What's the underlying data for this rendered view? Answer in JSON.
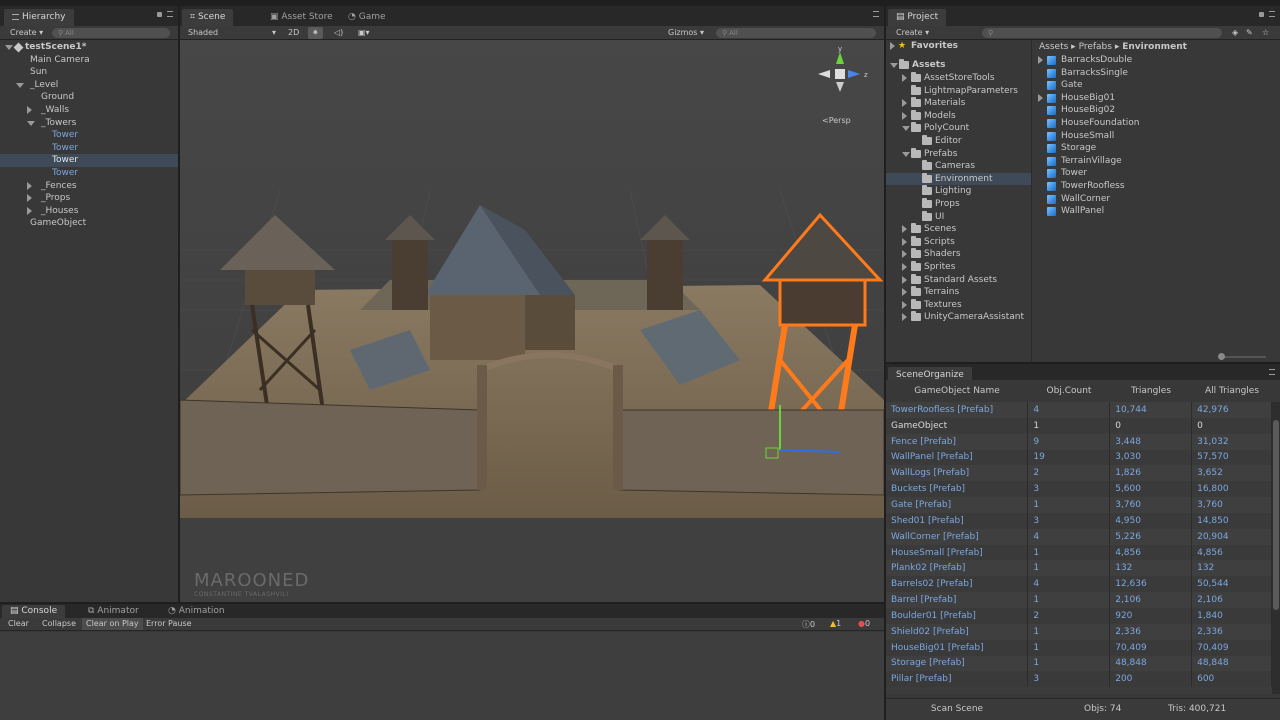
{
  "colors": {
    "prefab_blue": "#7ba7e0",
    "selection_orange": "#ff7a1a",
    "selected_row": "#3e4a58"
  },
  "hierarchy": {
    "tab": "Hierarchy",
    "create": "Create",
    "search_placeholder": "All",
    "items": [
      {
        "label": "testScene1*",
        "depth": 0,
        "arrow": "down",
        "bold": true,
        "prefab": false
      },
      {
        "label": "Main Camera",
        "depth": 1,
        "arrow": "",
        "bold": false,
        "prefab": false
      },
      {
        "label": "Sun",
        "depth": 1,
        "arrow": "",
        "bold": false,
        "prefab": false
      },
      {
        "label": "_Level",
        "depth": 1,
        "arrow": "down",
        "bold": false,
        "prefab": false
      },
      {
        "label": "Ground",
        "depth": 2,
        "arrow": "",
        "bold": false,
        "prefab": false
      },
      {
        "label": "_Walls",
        "depth": 2,
        "arrow": "right",
        "bold": false,
        "prefab": false
      },
      {
        "label": "_Towers",
        "depth": 2,
        "arrow": "down",
        "bold": false,
        "prefab": false
      },
      {
        "label": "Tower",
        "depth": 3,
        "arrow": "",
        "bold": false,
        "prefab": true
      },
      {
        "label": "Tower",
        "depth": 3,
        "arrow": "",
        "bold": false,
        "prefab": true
      },
      {
        "label": "Tower",
        "depth": 3,
        "arrow": "",
        "bold": false,
        "prefab": true,
        "selected": true
      },
      {
        "label": "Tower",
        "depth": 3,
        "arrow": "",
        "bold": false,
        "prefab": true
      },
      {
        "label": "_Fences",
        "depth": 2,
        "arrow": "right",
        "bold": false,
        "prefab": false
      },
      {
        "label": "_Props",
        "depth": 2,
        "arrow": "right",
        "bold": false,
        "prefab": false
      },
      {
        "label": "_Houses",
        "depth": 2,
        "arrow": "right",
        "bold": false,
        "prefab": false
      },
      {
        "label": "GameObject",
        "depth": 1,
        "arrow": "",
        "bold": false,
        "prefab": false
      }
    ]
  },
  "scene": {
    "tabs": [
      "Scene",
      "Asset Store",
      "Game"
    ],
    "shading": "Shaded",
    "mode_2d": "2D",
    "gizmos": "Gizmos",
    "search_placeholder": "All",
    "persp_label": "Persp",
    "watermark_title": "MAROONED",
    "watermark_sub": "CONSTANTINE TVALASHVILI"
  },
  "project": {
    "tab": "Project",
    "create": "Create",
    "favorites": "Favorites",
    "assets_root": "Assets",
    "breadcrumb": [
      "Assets",
      "Prefabs",
      "Environment"
    ],
    "folders": [
      {
        "label": "AssetStoreTools",
        "depth": 1,
        "arrow": "right"
      },
      {
        "label": "LightmapParameters",
        "depth": 1,
        "arrow": ""
      },
      {
        "label": "Materials",
        "depth": 1,
        "arrow": "right"
      },
      {
        "label": "Models",
        "depth": 1,
        "arrow": "right"
      },
      {
        "label": "PolyCount",
        "depth": 1,
        "arrow": "down"
      },
      {
        "label": "Editor",
        "depth": 2,
        "arrow": ""
      },
      {
        "label": "Prefabs",
        "depth": 1,
        "arrow": "down"
      },
      {
        "label": "Cameras",
        "depth": 2,
        "arrow": ""
      },
      {
        "label": "Environment",
        "depth": 2,
        "arrow": "",
        "selected": true
      },
      {
        "label": "Lighting",
        "depth": 2,
        "arrow": ""
      },
      {
        "label": "Props",
        "depth": 2,
        "arrow": ""
      },
      {
        "label": "UI",
        "depth": 2,
        "arrow": ""
      },
      {
        "label": "Scenes",
        "depth": 1,
        "arrow": "right"
      },
      {
        "label": "Scripts",
        "depth": 1,
        "arrow": "right"
      },
      {
        "label": "Shaders",
        "depth": 1,
        "arrow": "right"
      },
      {
        "label": "Sprites",
        "depth": 1,
        "arrow": "right"
      },
      {
        "label": "Standard Assets",
        "depth": 1,
        "arrow": "right"
      },
      {
        "label": "Terrains",
        "depth": 1,
        "arrow": "right"
      },
      {
        "label": "Textures",
        "depth": 1,
        "arrow": "right"
      },
      {
        "label": "UnityCameraAssistant",
        "depth": 1,
        "arrow": "right"
      }
    ],
    "files": [
      {
        "label": "BarracksDouble",
        "arrow": true
      },
      {
        "label": "BarracksSingle",
        "arrow": false
      },
      {
        "label": "Gate",
        "arrow": false
      },
      {
        "label": "HouseBig01",
        "arrow": true
      },
      {
        "label": "HouseBig02",
        "arrow": false
      },
      {
        "label": "HouseFoundation",
        "arrow": false
      },
      {
        "label": "HouseSmall",
        "arrow": false
      },
      {
        "label": "Storage",
        "arrow": false
      },
      {
        "label": "TerrainVillage",
        "arrow": false
      },
      {
        "label": "Tower",
        "arrow": false
      },
      {
        "label": "TowerRoofless",
        "arrow": false
      },
      {
        "label": "WallCorner",
        "arrow": false
      },
      {
        "label": "WallPanel",
        "arrow": false
      }
    ]
  },
  "scene_organize": {
    "tab": "SceneOrganize",
    "columns": [
      "GameObject Name",
      "Obj.Count",
      "Triangles",
      "All Triangles"
    ],
    "rows": [
      {
        "name": "TowerRoofless [Prefab]",
        "count": "4",
        "tris": "10,744",
        "all": "42,976",
        "prefab": true
      },
      {
        "name": "GameObject",
        "count": "1",
        "tris": "0",
        "all": "0",
        "prefab": false
      },
      {
        "name": "Fence [Prefab]",
        "count": "9",
        "tris": "3,448",
        "all": "31,032",
        "prefab": true
      },
      {
        "name": "WallPanel [Prefab]",
        "count": "19",
        "tris": "3,030",
        "all": "57,570",
        "prefab": true
      },
      {
        "name": "WallLogs [Prefab]",
        "count": "2",
        "tris": "1,826",
        "all": "3,652",
        "prefab": true
      },
      {
        "name": "Buckets [Prefab]",
        "count": "3",
        "tris": "5,600",
        "all": "16,800",
        "prefab": true
      },
      {
        "name": "Gate [Prefab]",
        "count": "1",
        "tris": "3,760",
        "all": "3,760",
        "prefab": true
      },
      {
        "name": "Shed01 [Prefab]",
        "count": "3",
        "tris": "4,950",
        "all": "14,850",
        "prefab": true
      },
      {
        "name": "WallCorner [Prefab]",
        "count": "4",
        "tris": "5,226",
        "all": "20,904",
        "prefab": true
      },
      {
        "name": "HouseSmall [Prefab]",
        "count": "1",
        "tris": "4,856",
        "all": "4,856",
        "prefab": true
      },
      {
        "name": "Plank02 [Prefab]",
        "count": "1",
        "tris": "132",
        "all": "132",
        "prefab": true
      },
      {
        "name": "Barrels02 [Prefab]",
        "count": "4",
        "tris": "12,636",
        "all": "50,544",
        "prefab": true
      },
      {
        "name": "Barrel [Prefab]",
        "count": "1",
        "tris": "2,106",
        "all": "2,106",
        "prefab": true
      },
      {
        "name": "Boulder01 [Prefab]",
        "count": "2",
        "tris": "920",
        "all": "1,840",
        "prefab": true
      },
      {
        "name": "Shield02 [Prefab]",
        "count": "1",
        "tris": "2,336",
        "all": "2,336",
        "prefab": true
      },
      {
        "name": "HouseBig01 [Prefab]",
        "count": "1",
        "tris": "70,409",
        "all": "70,409",
        "prefab": true
      },
      {
        "name": "Storage [Prefab]",
        "count": "1",
        "tris": "48,848",
        "all": "48,848",
        "prefab": true
      },
      {
        "name": "Pillar [Prefab]",
        "count": "3",
        "tris": "200",
        "all": "600",
        "prefab": true
      }
    ],
    "scan_button": "Scan Scene",
    "objs_label": "Objs: 74",
    "tris_label": "Tris: 400,721"
  },
  "console": {
    "tabs": [
      "Console",
      "Animator",
      "Animation"
    ],
    "buttons": [
      "Clear",
      "Collapse",
      "Clear on Play",
      "Error Pause"
    ],
    "counts": [
      "0",
      "1",
      "0"
    ]
  }
}
